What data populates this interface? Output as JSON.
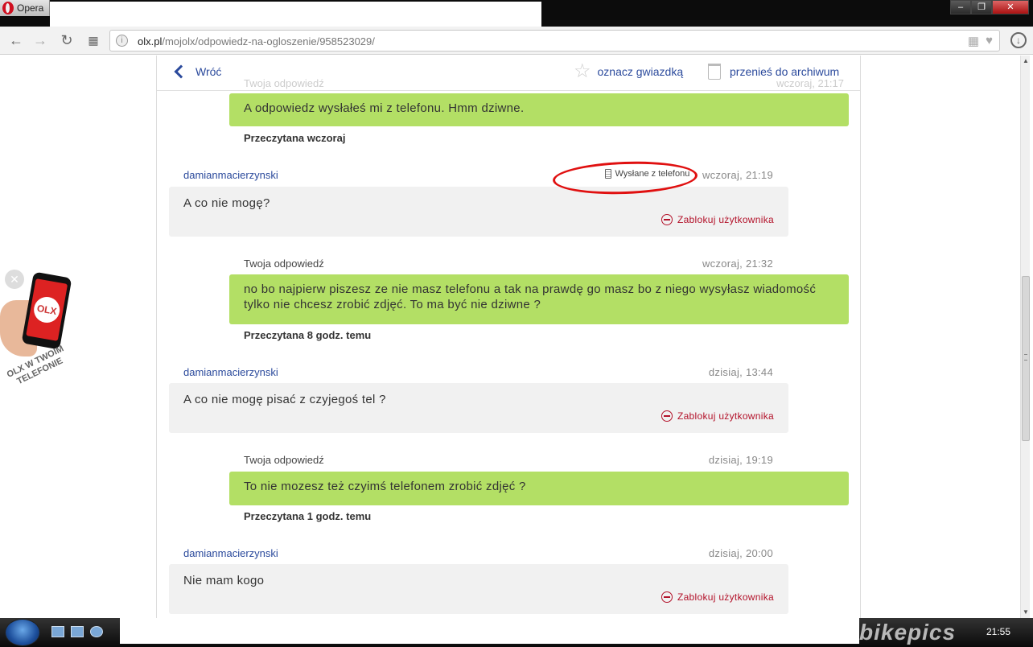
{
  "browser": {
    "opera_label": "Opera",
    "url_host": "olx.pl",
    "url_path": "/mojolx/odpowiedz-na-ogloszenie/958523029/"
  },
  "topbar": {
    "back_label": "Wróć",
    "star_label": "oznacz gwiazdką",
    "archive_label": "przenieś do archiwum",
    "ghost_label": "Twoja odpowiedź",
    "ghost_time": "wczoraj, 21:17"
  },
  "messages": {
    "m1": {
      "text": "A odpowiedz wysłałeś mi z telefonu. Hmm dziwne.",
      "read": "Przeczytana wczoraj"
    },
    "m2": {
      "user": "damianmacierzynski",
      "sent_from": "Wysłane z telefonu",
      "time": "wczoraj, 21:19",
      "text": "A co nie mogę?",
      "block": "Zablokuj użytkownika"
    },
    "m3": {
      "label": "Twoja odpowiedź",
      "time": "wczoraj, 21:32",
      "text": "no bo najpierw piszesz ze nie masz telefonu a tak na prawdę go masz bo z niego wysyłasz wiadomość tylko nie chcesz zrobić zdjęć. To ma być nie dziwne ?",
      "read": "Przeczytana 8 godz. temu"
    },
    "m4": {
      "user": "damianmacierzynski",
      "time": "dzisiaj, 13:44",
      "text": "A co nie mogę pisać z czyjegoś tel ?",
      "block": "Zablokuj użytkownika"
    },
    "m5": {
      "label": "Twoja odpowiedź",
      "time": "dzisiaj, 19:19",
      "text": "To nie mozesz też czyimś telefonem zrobić zdjęć ?",
      "read": "Przeczytana 1 godz. temu"
    },
    "m6": {
      "user": "damianmacierzynski",
      "time": "dzisiaj, 20:00",
      "text": "Nie mam kogo",
      "block": "Zablokuj użytkownika"
    }
  },
  "ad": {
    "logo": "OLX",
    "text": "OLX W TWOIM TELEFONIE"
  },
  "taskbar": {
    "clock": "21:55",
    "watermark": "bikepics"
  },
  "colors": {
    "my_bubble": "#b3df65",
    "other_bubble": "#f1f1f1",
    "link": "#2b4a9c",
    "block": "#b3122a",
    "annotation": "#e01010"
  }
}
